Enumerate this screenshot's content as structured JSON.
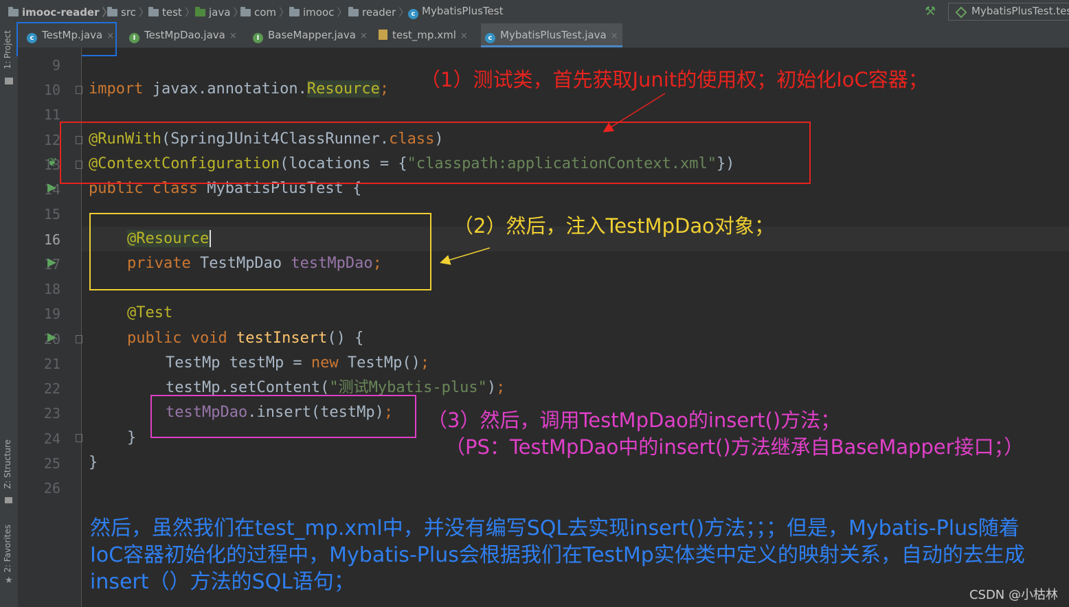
{
  "breadcrumb": {
    "items": [
      "imooc-reader",
      "src",
      "test",
      "java",
      "com",
      "imooc",
      "reader",
      "MybatisPlusTest"
    ]
  },
  "run_config": {
    "label": "MybatisPlusTest.tes"
  },
  "tabs": [
    {
      "label": "TestMp.java",
      "icon": "class-icon"
    },
    {
      "label": "TestMpDao.java",
      "icon": "interface-icon"
    },
    {
      "label": "BaseMapper.java",
      "icon": "interface-icon"
    },
    {
      "label": "test_mp.xml",
      "icon": "xml-file-icon"
    },
    {
      "label": "MybatisPlusTest.java",
      "icon": "test-class-icon"
    }
  ],
  "tool_windows": {
    "project": "1: Project",
    "structure": "Z: Structure",
    "favorites": "2: Favorites"
  },
  "gutter": {
    "line_numbers": [
      "9",
      "10",
      "11",
      "12",
      "13",
      "14",
      "15",
      "16",
      "17",
      "18",
      "19",
      "20",
      "21",
      "22",
      "23",
      "24",
      "25",
      "26"
    ],
    "current_line": "16"
  },
  "code": {
    "l10": {
      "k": "import",
      "a": " javax.annotation.",
      "b": "Resource",
      "c": ";"
    },
    "l12": {
      "a": "@RunWith",
      "b": "(SpringJUnit4ClassRunner.",
      "c": "class",
      "d": ")"
    },
    "l13": {
      "a": "@ContextConfiguration",
      "b": "(locations = {",
      "c": "\"classpath:applicationContext.xml\"",
      "d": "})"
    },
    "l14": {
      "a": "public class",
      "b": " MybatisPlusTest {"
    },
    "l16": {
      "a": "@Resource"
    },
    "l17": {
      "a": "private",
      "b": " TestMpDao ",
      "c": "testMpDao",
      "d": ";"
    },
    "l19": {
      "a": "@Test"
    },
    "l20": {
      "a": "public void",
      "b": " ",
      "c": "testInsert",
      "d": "() {"
    },
    "l21": {
      "a": "TestMp testMp = ",
      "b": "new",
      "c": " TestMp()",
      "d": ";"
    },
    "l22": {
      "a": "testMp.setContent(",
      "b": "\"测试Mybatis-plus\"",
      "c": ")",
      "d": ";"
    },
    "l23": {
      "a": "testMpDao",
      "b": ".insert(testMp)",
      "c": ";"
    },
    "l24": {
      "a": "}"
    },
    "l25": {
      "a": "}"
    }
  },
  "annotations": {
    "note1": "（1）测试类，首先获取Junit的使用权；初始化IoC容器；",
    "note2": "（2）然后，注入TestMpDao对象；",
    "note3": "（3）然后，调用TestMpDao的insert()方法；",
    "note3b": "（PS：TestMpDao中的insert()方法继承自BaseMapper接口；）",
    "note4": "然后，虽然我们在test_mp.xml中，并没有编写SQL去实现insert()方法；；；但是，Mybatis-Plus随着IoC容器初始化的过程中，Mybatis-Plus会根据我们在TestMp实体类中定义的映射关系，自动的去生成insert（）方法的SQL语句；"
  },
  "watermark": "CSDN @小枯林",
  "colors": {
    "annotation_red": "#e8231e",
    "annotation_yellow": "#f0d032",
    "annotation_pink": "#e040c8",
    "annotation_blue": "#2f7ff0",
    "tab_highlight": "#1f6fe0"
  }
}
